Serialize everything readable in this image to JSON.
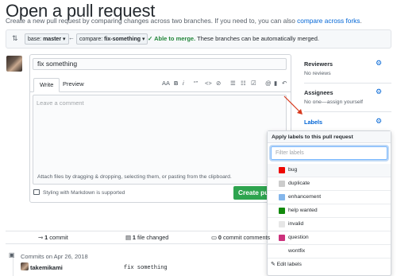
{
  "page": {
    "title": "Open a pull request",
    "subtitle": "Create a new pull request by comparing changes across two branches. If you need to, you can also",
    "subtitle_link": "compare across forks",
    "subtitle_end": "."
  },
  "compare": {
    "base_label": "base: ",
    "base_value": "master",
    "compare_label": "compare: ",
    "compare_value": "fix-something",
    "status_strong": "✓ Able to merge.",
    "status_rest": " These branches can be automatically merged."
  },
  "form": {
    "title_value": "fix something",
    "tab_write": "Write",
    "tab_preview": "Preview",
    "toolbar": [
      "AA",
      "B",
      "i",
      "“”",
      "<>",
      "⊘",
      "☰",
      "☷",
      "☑",
      "@",
      "▮",
      "↶"
    ],
    "comment_placeholder": "Leave a comment",
    "attach_text": "Attach files by dragging & dropping, selecting them, or pasting from the clipboard.",
    "markdown_text": "Styling with Markdown is supported",
    "create_button": "Create pull"
  },
  "sidebar": {
    "reviewers_title": "Reviewers",
    "reviewers_text": "No reviews",
    "assignees_title": "Assignees",
    "assignees_text": "No one—assign yourself",
    "labels_title": "Labels"
  },
  "labels_popup": {
    "header": "Apply labels to this pull request",
    "filter_placeholder": "Filter labels",
    "items": [
      {
        "name": "bug",
        "color": "#ee0701"
      },
      {
        "name": "duplicate",
        "color": "#cccccc"
      },
      {
        "name": "enhancement",
        "color": "#84b6eb"
      },
      {
        "name": "help wanted",
        "color": "#128a0c"
      },
      {
        "name": "invalid",
        "color": "#e6e6e6"
      },
      {
        "name": "question",
        "color": "#cc317c"
      },
      {
        "name": "wontfix",
        "color": "#ffffff"
      }
    ],
    "edit_label": "✎ Edit labels"
  },
  "stats": {
    "commits_count": "1",
    "commits_label": " commit",
    "files_count": "1",
    "files_label": " file changed",
    "comments_count": "0",
    "comments_label": " commit comments"
  },
  "commits": {
    "date_header": "Commits on Apr 26, 2018",
    "user": "takemikami",
    "message": "fix something"
  }
}
